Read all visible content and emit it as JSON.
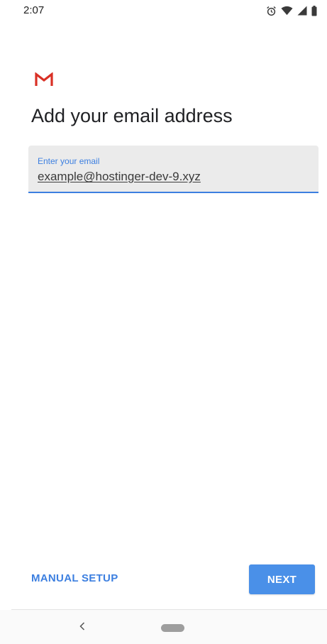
{
  "status_bar": {
    "time": "2:07",
    "icons": [
      "alarm-icon",
      "wifi-icon",
      "signal-icon",
      "battery-icon"
    ]
  },
  "app": {
    "logo": "gmail-logo-icon",
    "brand_color": "#d93025"
  },
  "page": {
    "title": "Add your email address"
  },
  "email_field": {
    "label": "Enter your email",
    "value": "example@hostinger-dev-9.xyz",
    "accent_color": "#3c7fe0"
  },
  "actions": {
    "manual_setup_label": "MANUAL SETUP",
    "next_label": "NEXT"
  },
  "nav": {
    "back_icon": "back-chevron-icon",
    "home_icon": "home-pill-icon"
  }
}
